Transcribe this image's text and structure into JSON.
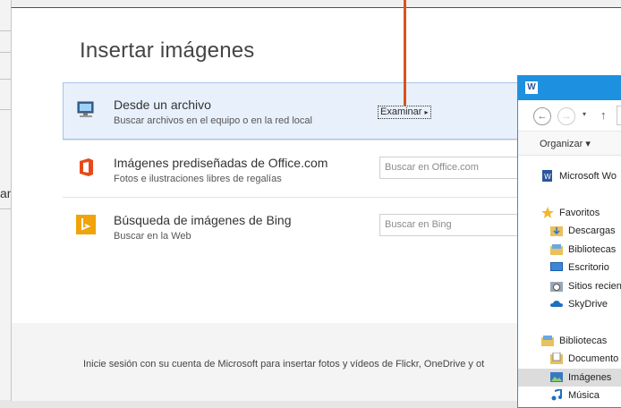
{
  "background": {
    "left_fragment": "an"
  },
  "dialog": {
    "title": "Insertar imágenes",
    "options": [
      {
        "title": "Desde un archivo",
        "subtitle": "Buscar archivos en el equipo o en la red local",
        "action": "Examinar",
        "icon": "computer-icon"
      },
      {
        "title": "Imágenes prediseñadas de Office.com",
        "subtitle": "Fotos e ilustraciones libres de regalías",
        "search_placeholder": "Buscar en Office.com",
        "icon": "office-logo-icon"
      },
      {
        "title": "Búsqueda de imágenes de Bing",
        "subtitle": "Buscar en la Web",
        "search_placeholder": "Buscar en Bing",
        "icon": "bing-logo-icon"
      }
    ],
    "footer_text": "Inicie sesión con su cuenta de Microsoft para insertar fotos y vídeos de Flickr, OneDrive y ot"
  },
  "explorer": {
    "title_icon": "W",
    "toolbar": {
      "organize": "Organizar ▾"
    },
    "nav": {
      "back": "←",
      "forward": "→",
      "dropdown": "▾",
      "up": "↑"
    },
    "tree": [
      {
        "label": "Microsoft Wo",
        "icon": "word-doc-icon"
      },
      {
        "label": "Favoritos",
        "icon": "star-icon"
      },
      {
        "label": "Descargas",
        "icon": "downloads-folder-icon"
      },
      {
        "label": "Bibliotecas",
        "icon": "library-folder-icon"
      },
      {
        "label": "Escritorio",
        "icon": "desktop-icon"
      },
      {
        "label": "Sitios recien",
        "icon": "recent-places-icon"
      },
      {
        "label": "SkyDrive",
        "icon": "cloud-icon"
      },
      {
        "label": "Bibliotecas",
        "icon": "library-folder-icon"
      },
      {
        "label": "Documento",
        "icon": "documents-icon"
      },
      {
        "label": "Imágenes",
        "icon": "pictures-icon",
        "selected": true
      },
      {
        "label": "Música",
        "icon": "music-icon"
      }
    ]
  },
  "colors": {
    "accent": "#2b579a",
    "callout": "#d9531e",
    "explorer_title": "#1e90e0",
    "office": "#e64a19",
    "bing": "#f0a30a"
  }
}
